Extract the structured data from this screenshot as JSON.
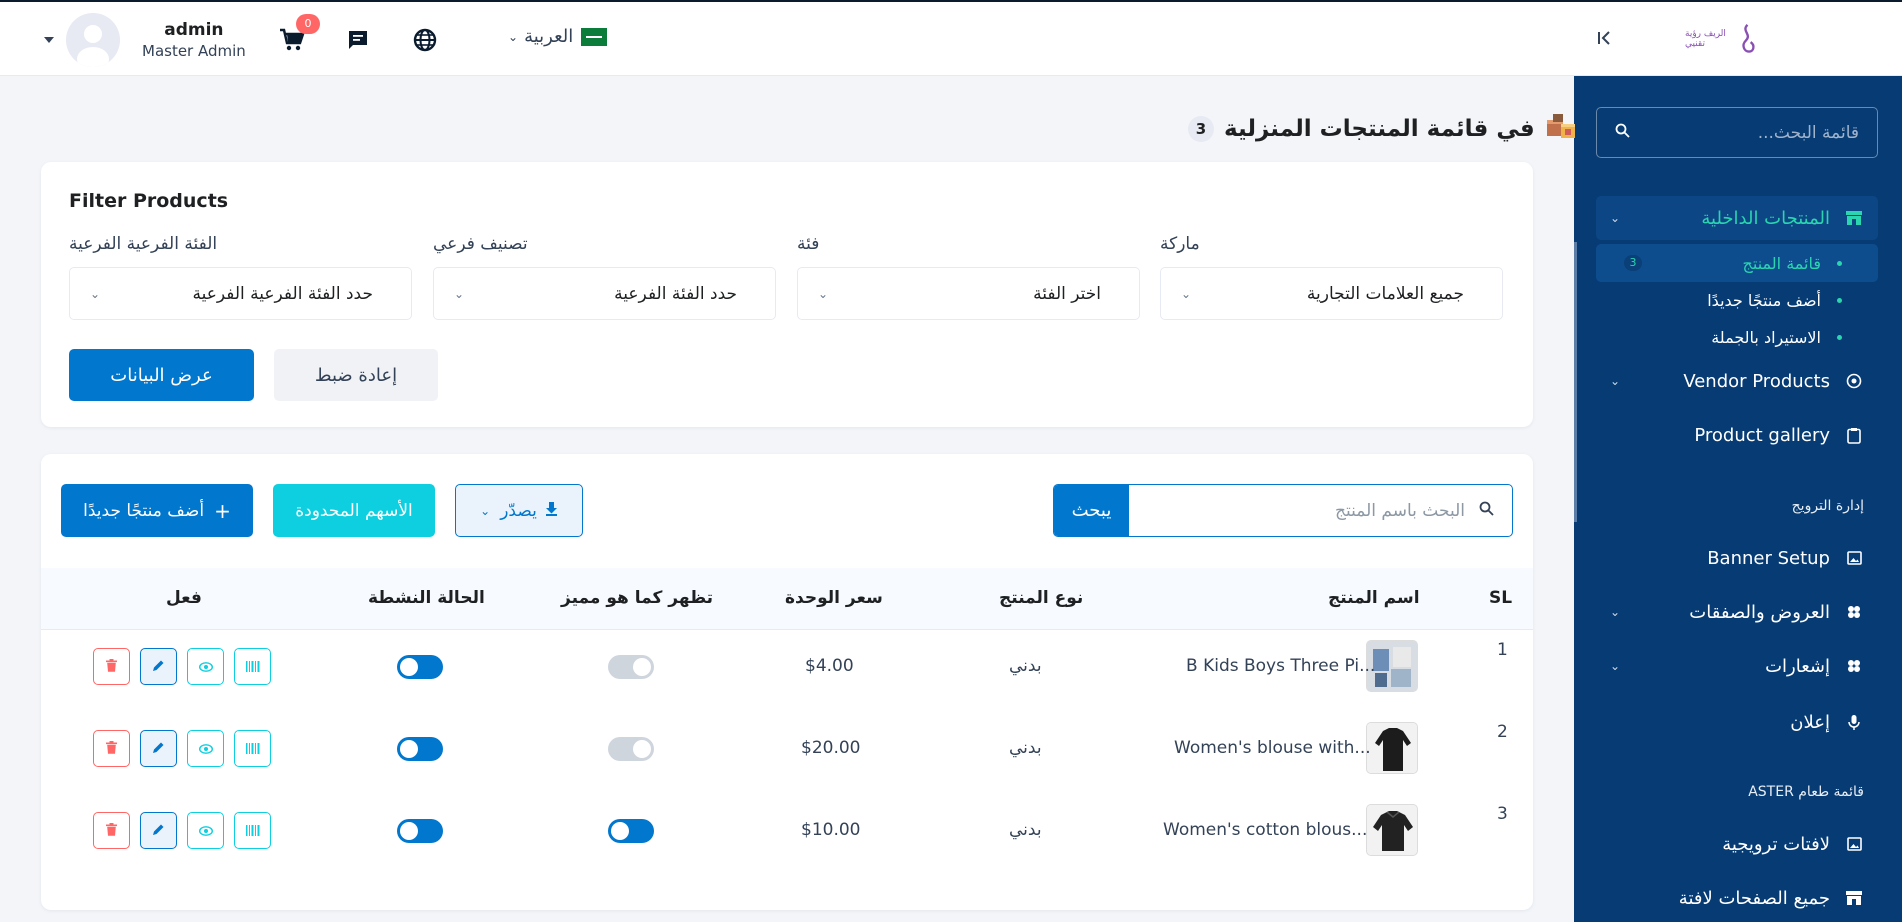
{
  "header": {
    "user_name": "admin",
    "user_role": "Master Admin",
    "cart_count": "0",
    "language": "العربية",
    "logo_text": "الريف رؤية تقنيي"
  },
  "sidebar": {
    "search_placeholder": "قائمة البحث...",
    "items": [
      {
        "label": "المنتجات الداخلية"
      },
      {
        "label": "قائمة المنتج",
        "count": "3"
      },
      {
        "label": "أضف منتجًا جديدًا"
      },
      {
        "label": "الاستيراد بالجملة"
      },
      {
        "label": "Vendor Products"
      },
      {
        "label": "Product gallery"
      },
      {
        "label": "إدارة الترويج"
      },
      {
        "label": "Banner Setup"
      },
      {
        "label": "العروض والصفقات"
      },
      {
        "label": "إشعارات"
      },
      {
        "label": "إعلان"
      },
      {
        "label": "ASTER قائمة طعام"
      },
      {
        "label": "لافتات ترويجية"
      },
      {
        "label": "جميع الصفحات لافتة"
      }
    ]
  },
  "page": {
    "title": "في قائمة المنتجات المنزلية",
    "count": "3"
  },
  "filter": {
    "title": "Filter Products",
    "brand_label": "ماركة",
    "brand_value": "جميع العلامات التجارية",
    "category_label": "فئة",
    "category_value": "اختر الفئة",
    "subcategory_label": "تصنيف فرعي",
    "subcategory_value": "حدد الفئة الفرعية",
    "subsub_label": "الفئة الفرعية الفرعية",
    "subsub_value": "حدد الفئة الفرعية الفرعية",
    "reset_label": "إعادة ضبط",
    "show_label": "عرض البيانات"
  },
  "toolbar": {
    "search_placeholder": "البحث باسم المنتج",
    "search_button": "يبحث",
    "export_label": "يصدّر",
    "limited_label": "الأسهم المحدودة",
    "add_label": "أضف منتجًا جديدًا"
  },
  "table": {
    "headers": {
      "sl": "SL",
      "name": "اسم المنتج",
      "type": "نوع المنتج",
      "price": "سعر الوحدة",
      "featured": "تظهر كما هو مميز",
      "status": "الحالة النشطة",
      "action": "فعل"
    },
    "rows": [
      {
        "sl": "1",
        "name": "B Kids Boys Three Pi...",
        "type": "بدني",
        "price": "$4.00",
        "featured": false,
        "active": true
      },
      {
        "sl": "2",
        "name": "Women's blouse with...",
        "type": "بدني",
        "price": "$20.00",
        "featured": false,
        "active": true
      },
      {
        "sl": "3",
        "name": "Women's cotton blous...",
        "type": "بدني",
        "price": "$10.00",
        "featured": true,
        "active": true
      }
    ]
  },
  "colors": {
    "primary": "#0177cd",
    "sidebar": "#073b74",
    "accent": "#2ad5b0",
    "danger": "#ff6767",
    "info": "#0dcfe0"
  }
}
